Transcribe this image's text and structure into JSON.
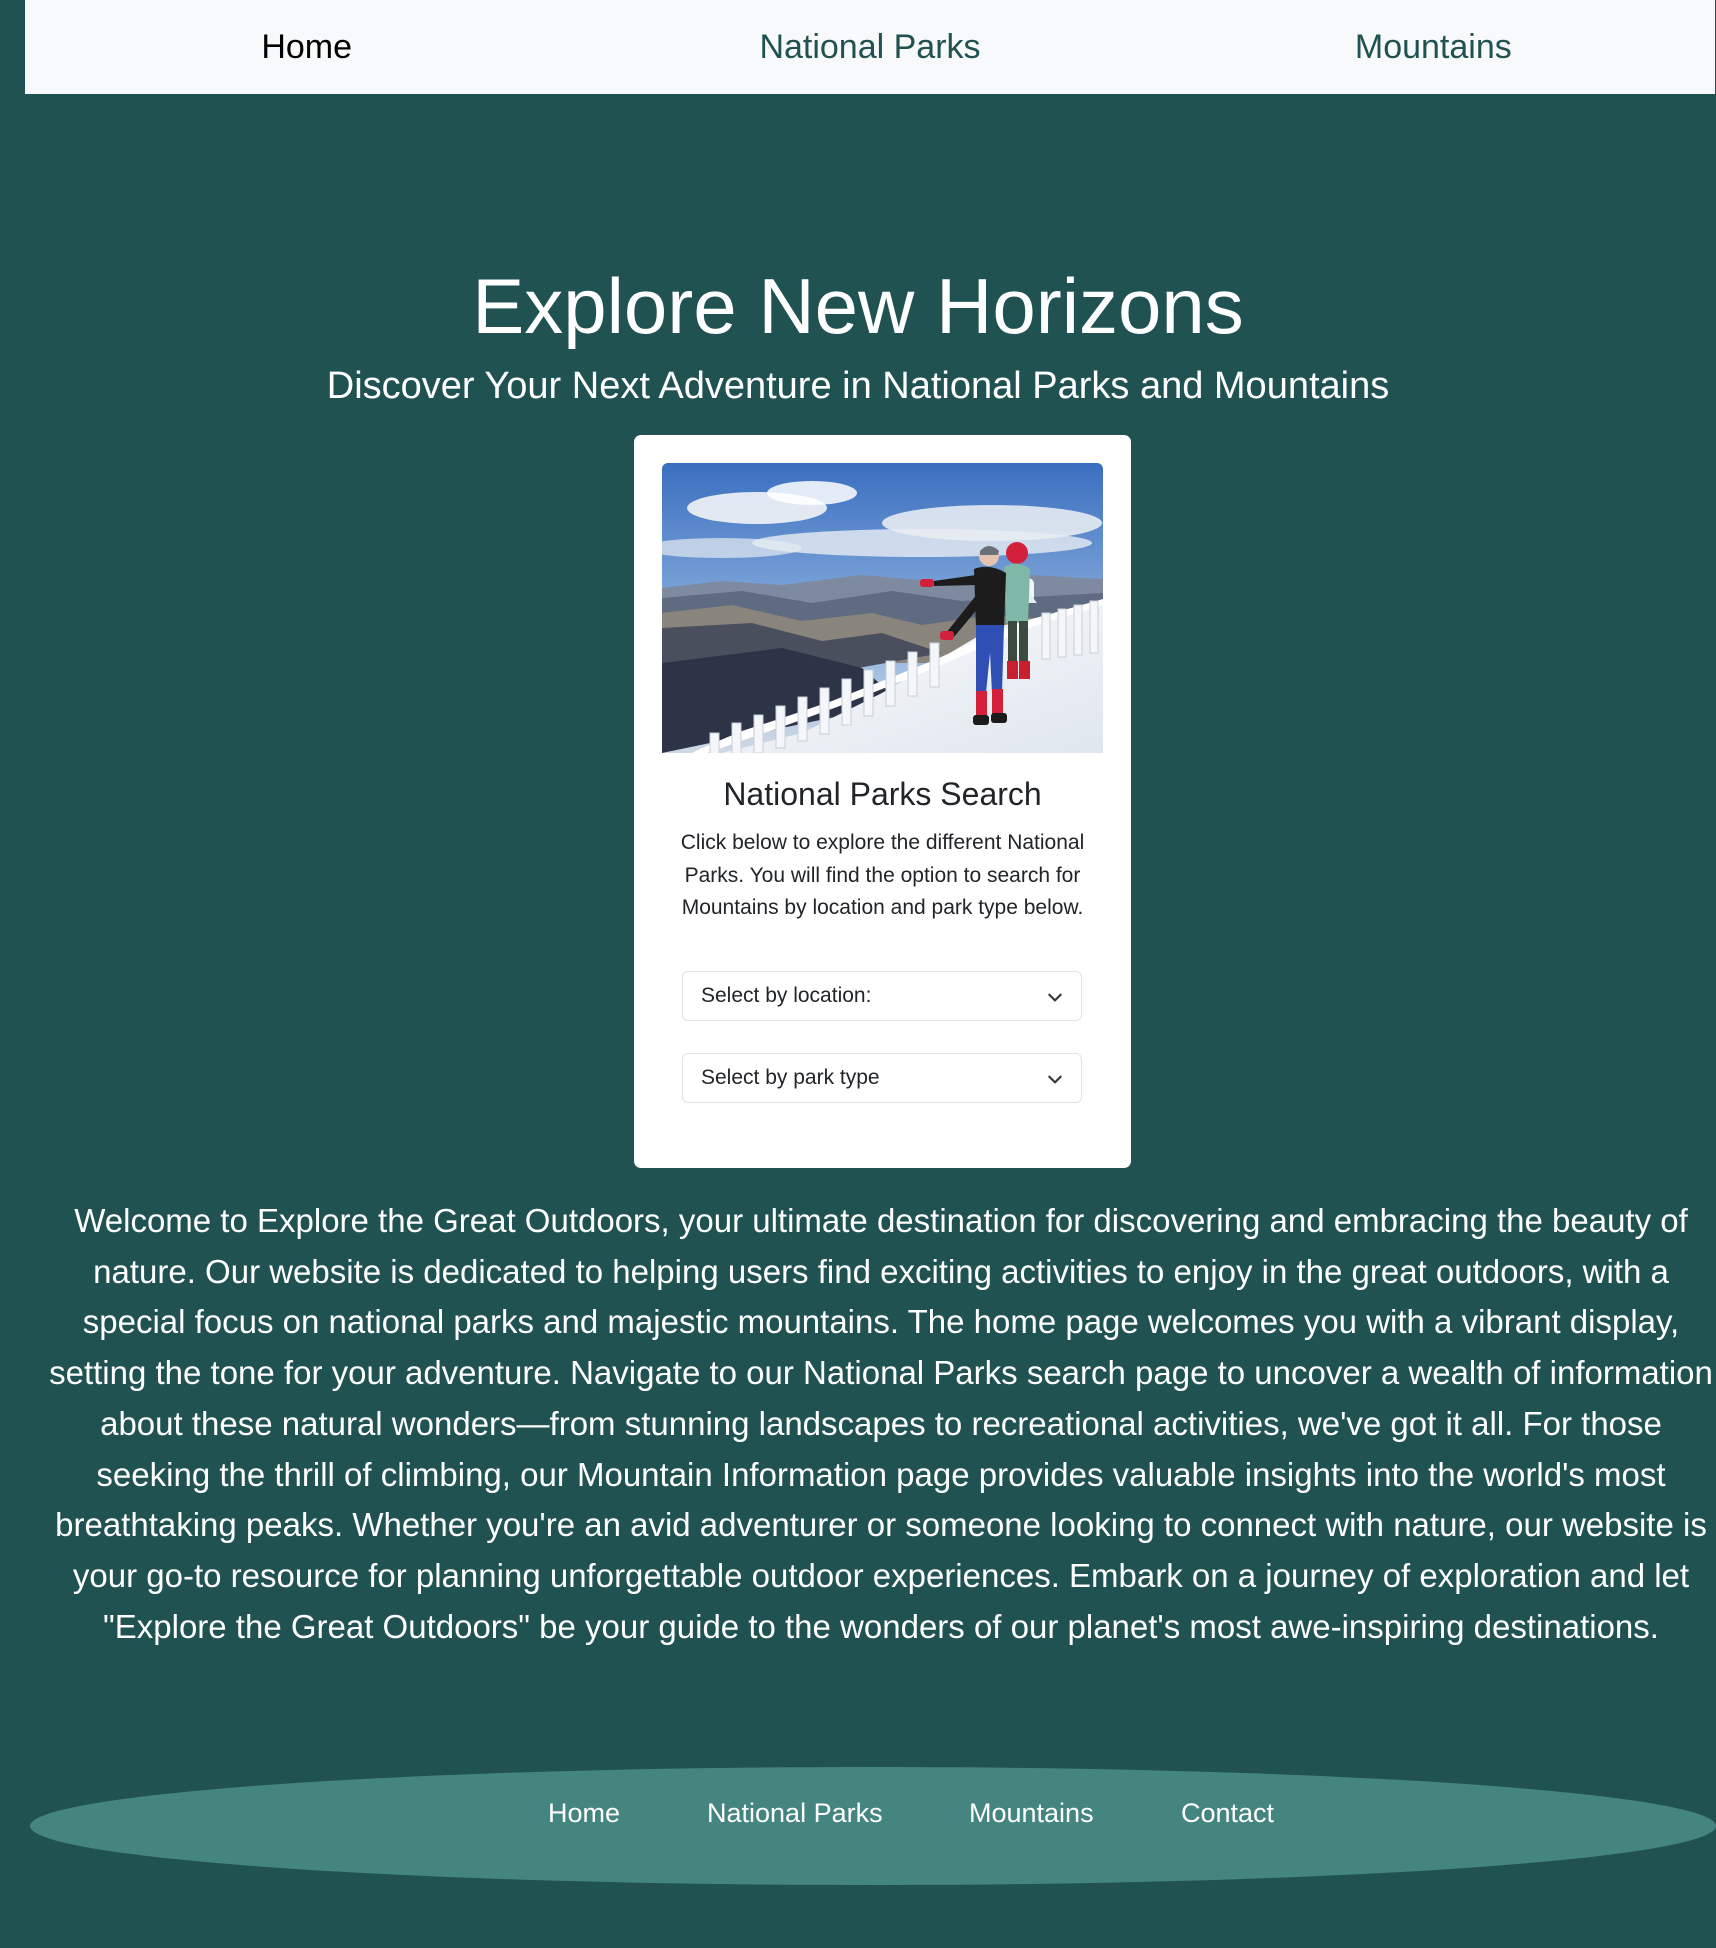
{
  "nav": {
    "items": [
      {
        "label": "Home",
        "active": true
      },
      {
        "label": "National Parks",
        "active": false
      },
      {
        "label": "Mountains",
        "active": false
      }
    ]
  },
  "hero": {
    "title": "Explore New Horizons",
    "subtitle": "Discover Your Next Adventure in National Parks and Mountains"
  },
  "search_card": {
    "title": "National Parks Search",
    "text": "Click below to explore the different National Parks. You will find the option to search for Mountains by location and park type below.",
    "location_select": "Select by location:",
    "parktype_select": "Select by park type"
  },
  "about": {
    "text": "Welcome to Explore the Great Outdoors, your ultimate destination for discovering and embracing the beauty of nature. Our website is dedicated to helping users find exciting activities to enjoy in the great outdoors, with a special focus on national parks and majestic mountains. The home page welcomes you with a vibrant display, setting the tone for your adventure. Navigate to our National Parks search page to uncover a wealth of information about these natural wonders—from stunning landscapes to recreational activities, we've got it all. For those seeking the thrill of climbing, our Mountain Information page provides valuable insights into the world's most breathtaking peaks. Whether you're an avid adventurer or someone looking to connect with nature, our website is your go-to resource for planning unforgettable outdoor experiences. Embark on a journey of exploration and let \"Explore the Great Outdoors\" be your guide to the wonders of our planet's most awe-inspiring destinations."
  },
  "footer": {
    "links": [
      {
        "label": "Home"
      },
      {
        "label": "National Parks"
      },
      {
        "label": "Mountains"
      },
      {
        "label": "Contact"
      }
    ]
  },
  "colors": {
    "page_background": "#215252",
    "nav_background": "#f8f9fa",
    "nav_text": "#215252",
    "footer_ellipse": "#458580"
  },
  "icons": {
    "select_chevron": "chevron-down-icon"
  }
}
